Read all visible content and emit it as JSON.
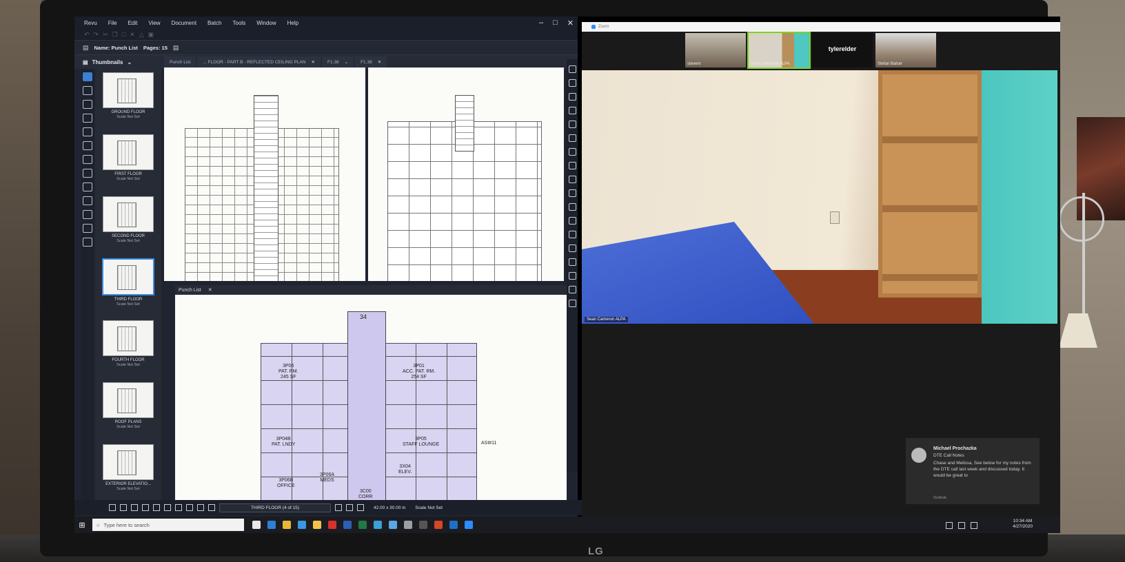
{
  "revu": {
    "menu": [
      "Revu",
      "File",
      "Edit",
      "View",
      "Document",
      "Batch",
      "Tools",
      "Window",
      "Help"
    ],
    "name_label": "Name: Punch List",
    "pages_label": "Pages: 15",
    "panel_title": "Thumbnails",
    "tabs": [
      {
        "label": "Punch List"
      },
      {
        "label": "... FLOOR - PART B - REFLECTED CEILING PLAN"
      },
      {
        "label": "F1.38"
      },
      {
        "label": "F1.38"
      }
    ],
    "thumbnails": [
      {
        "name": "GROUND FLOOR",
        "scale": "Scale Not Set",
        "selected": false
      },
      {
        "name": "FIRST FLOOR",
        "scale": "Scale Not Set",
        "selected": false
      },
      {
        "name": "SECOND FLOOR",
        "scale": "Scale Not Set",
        "selected": false
      },
      {
        "name": "THIRD FLOOR",
        "scale": "Scale Not Set",
        "selected": true
      },
      {
        "name": "FOURTH FLOOR",
        "scale": "Scale Not Set",
        "selected": false
      },
      {
        "name": "ROOF PLANS",
        "scale": "Scale Not Set",
        "selected": false
      },
      {
        "name": "EXTERIOR ELEVATIO...",
        "scale": "Scale Not Set",
        "selected": false
      }
    ],
    "bottom_pane_title": "Punch List",
    "plan_labels": {
      "room_34": "34",
      "patrm": "3P06\nPAT. RM.\n245 SF",
      "acc": "3P01\nACC. PAT. RM.\n254 SF",
      "patlndy": "3P04B\nPAT. LNDY",
      "staff": "3P05\nSTAFF LOUNGE",
      "office": "3P06B\nOFFICE",
      "elev": "3X04\nELEV.",
      "meds": "3P06A\nMEDS",
      "asi": "ASI#11",
      "corr": "3C00\nCORR"
    },
    "status": {
      "page": "THIRD FLOOR (4 of 15)",
      "size": "42.00 x 30.00 in",
      "scale": "Scale Not Set"
    }
  },
  "zoom": {
    "title": "Zoom",
    "participants": [
      {
        "name": "stevenr",
        "speaking": false
      },
      {
        "name": "Sean Cameron ALPA",
        "speaking": true
      },
      {
        "name": "tylerelder",
        "speaking": false
      },
      {
        "name": "Stefan Balcer",
        "speaking": false
      }
    ],
    "active_speaker": "Sean Cameron ALPA"
  },
  "notification": {
    "sender": "Michael Prochazka",
    "subject": "DTE Call Notes",
    "body": "Chase and Melissa,  See below for my notes from the DTE call last week and discussed today.  It would be great to",
    "app": "Outlook"
  },
  "taskbar": {
    "search_placeholder": "Type here to search",
    "time": "10:34 AM",
    "date": "4/27/2020"
  },
  "monitor": {
    "brand": "LG"
  }
}
